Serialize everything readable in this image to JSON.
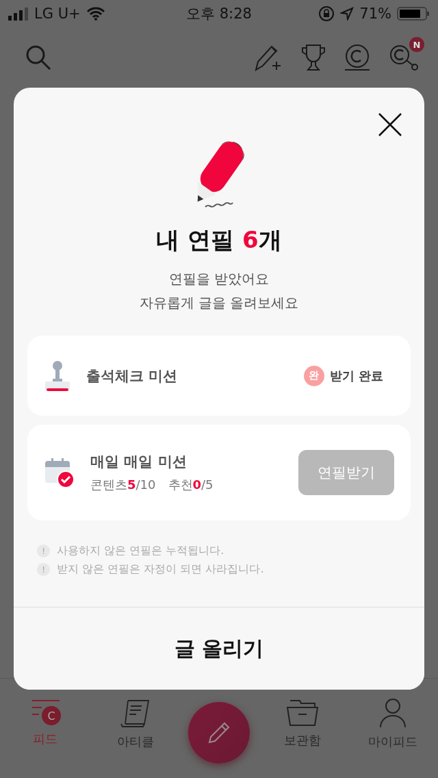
{
  "status_bar": {
    "carrier": "LG U+",
    "time": "오후 8:28",
    "battery": "71%"
  },
  "top_bar": {
    "badge": "N"
  },
  "modal": {
    "title": {
      "prefix": "내 연필 ",
      "count": "6",
      "suffix": "개"
    },
    "subtitle": [
      "연필을 받았어요",
      "자유롭게 글을 올려보세요"
    ],
    "missions": [
      {
        "kind": "stamp",
        "title": "출석체크 미션",
        "badge": "완",
        "status": "받기 완료"
      },
      {
        "kind": "calendar",
        "title": "매일 매일 미션",
        "progress": [
          {
            "label": "콘텐츠",
            "done": "5",
            "total": "/10"
          },
          {
            "label": "추천",
            "done": "0",
            "total": "/5"
          }
        ],
        "button": {
          "label": "연필받기",
          "disabled": true
        }
      }
    ],
    "notes": [
      {
        "mark": "!",
        "text": "사용하지 않은 연필은 누적됩니다."
      },
      {
        "mark": "!",
        "text": "받지 않은 연필은 자정이 되면 사라집니다."
      }
    ],
    "submit": "글 올리기"
  },
  "tabs": [
    {
      "kind": "feed",
      "label": "피드",
      "badge": "C",
      "selected": true
    },
    {
      "kind": "article",
      "label": "아티클",
      "selected": false
    },
    {
      "kind": "compose"
    },
    {
      "kind": "archive",
      "label": "보관함",
      "selected": false
    },
    {
      "kind": "profile",
      "label": "마이피드",
      "selected": false
    }
  ]
}
